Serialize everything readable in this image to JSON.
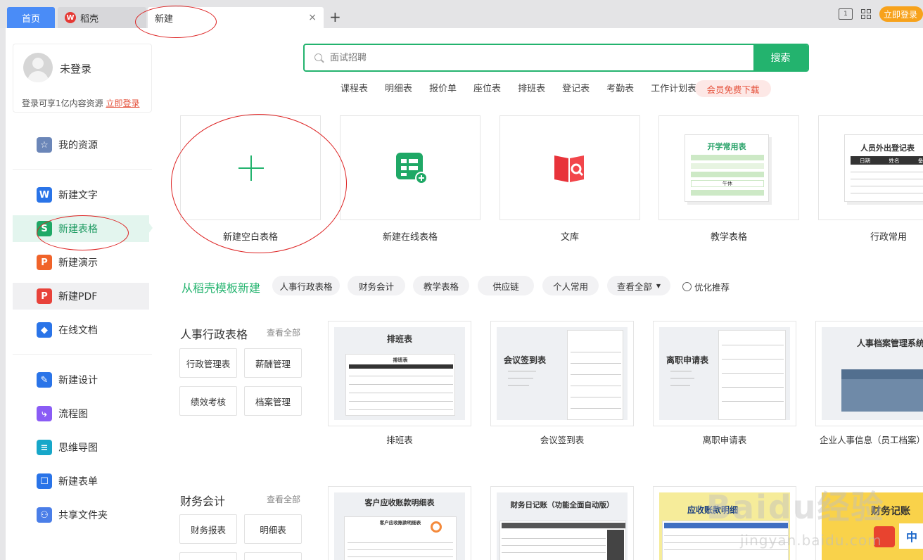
{
  "tabs": {
    "home": "首页",
    "daoke": "稻壳",
    "daoke_logo": "W",
    "new": "新建",
    "close": "×",
    "add": "+"
  },
  "top_right": {
    "split_icon": "1",
    "login": "立即登录"
  },
  "user": {
    "name": "未登录",
    "tip": "登录可享1亿内容资源",
    "login_link": "立即登录"
  },
  "sidebar": {
    "items": [
      {
        "label": "我的资源",
        "icon": "star-icon",
        "color": "#6b86b8",
        "glyph": "☆"
      },
      {
        "label": "新建文字",
        "icon": "writer-icon",
        "color": "#2a74e8",
        "glyph": "W"
      },
      {
        "label": "新建表格",
        "icon": "spreadsheet-icon",
        "color": "#1fa866",
        "glyph": "S"
      },
      {
        "label": "新建演示",
        "icon": "presentation-icon",
        "color": "#f0632a",
        "glyph": "P"
      },
      {
        "label": "新建PDF",
        "icon": "pdf-icon",
        "color": "#e8423a",
        "glyph": "P"
      },
      {
        "label": "在线文档",
        "icon": "online-doc-icon",
        "color": "#2a74e8",
        "glyph": "◆"
      },
      {
        "label": "新建设计",
        "icon": "design-icon",
        "color": "#2a74e8",
        "glyph": "✎"
      },
      {
        "label": "流程图",
        "icon": "flowchart-icon",
        "color": "#8a5cf5",
        "glyph": "⤷"
      },
      {
        "label": "思维导图",
        "icon": "mindmap-icon",
        "color": "#17a7c9",
        "glyph": "≡"
      },
      {
        "label": "新建表单",
        "icon": "form-icon",
        "color": "#2a74e8",
        "glyph": "☐"
      },
      {
        "label": "共享文件夹",
        "icon": "shared-folder-icon",
        "color": "#4a7ee8",
        "glyph": "⚇"
      }
    ]
  },
  "search": {
    "placeholder": "面试招聘",
    "button": "搜索"
  },
  "hot_tags": [
    "课程表",
    "明细表",
    "报价单",
    "座位表",
    "排班表",
    "登记表",
    "考勤表",
    "工作计划表"
  ],
  "vip_tag": "会员免费下载",
  "big_cards": [
    {
      "label": "新建空白表格"
    },
    {
      "label": "新建在线表格"
    },
    {
      "label": "文库"
    },
    {
      "label": "教学表格",
      "thumb_title": "开学常用表",
      "thumb_row": "午休"
    },
    {
      "label": "行政常用",
      "thumb_title": "人员外出登记表",
      "thumb_cols": [
        "日期",
        "姓名",
        "备注"
      ]
    }
  ],
  "template_section": {
    "title": "从稻壳模板新建",
    "chips": [
      "人事行政表格",
      "财务会计",
      "教学表格",
      "供应链",
      "个人常用",
      "查看全部"
    ],
    "dropdown_arrow": "▼",
    "recommend": "优化推荐"
  },
  "categories": [
    {
      "title": "人事行政表格",
      "more": "查看全部",
      "buttons": [
        "行政管理表",
        "薪酬管理",
        "绩效考核",
        "档案管理"
      ],
      "templates": [
        {
          "label": "排班表",
          "thumb": "排班表",
          "thumb_sub": "排班表"
        },
        {
          "label": "会议签到表",
          "thumb": "会议签到表"
        },
        {
          "label": "离职申请表",
          "thumb": "离职申请表"
        },
        {
          "label": "企业人事信息（员工档案）管",
          "thumb": "人事档案管理系统"
        }
      ]
    },
    {
      "title": "财务会计",
      "more": "查看全部",
      "buttons": [
        "财务报表",
        "明细表"
      ],
      "templates": [
        {
          "thumb": "客户应收账款明细表",
          "thumb_sub": "客户应收账款明细表"
        },
        {
          "thumb": "财务日记账（功能全面自动版）"
        },
        {
          "thumb": "应收账款明细"
        },
        {
          "thumb": "财务记账",
          "badge": "中"
        }
      ]
    }
  ],
  "watermark": {
    "brand": "Baidu经验",
    "url": "jingyan.baidu.com"
  },
  "colors": {
    "accent": "#23b36e",
    "tab_home": "#4a8cf7",
    "login": "#f7a21b",
    "vip": "#e5533d"
  }
}
